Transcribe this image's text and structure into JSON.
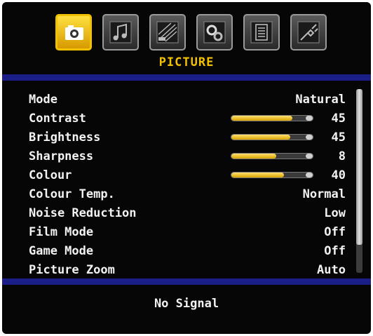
{
  "tabs": [
    {
      "icon": "camera-icon",
      "active": true
    },
    {
      "icon": "music-note-icon",
      "active": false
    },
    {
      "icon": "satellite-install-icon",
      "active": false
    },
    {
      "icon": "gears-icon",
      "active": false
    },
    {
      "icon": "document-icon",
      "active": false
    },
    {
      "icon": "plug-icon",
      "active": false
    }
  ],
  "section_title": "PICTURE",
  "menu": {
    "items": [
      {
        "label": "Mode",
        "value": "Natural"
      },
      {
        "label": "Contrast",
        "value": "45",
        "level": 0.75
      },
      {
        "label": "Brightness",
        "value": "45",
        "level": 0.72
      },
      {
        "label": "Sharpness",
        "value": "8",
        "level": 0.55
      },
      {
        "label": "Colour",
        "value": "40",
        "level": 0.65
      },
      {
        "label": "Colour Temp.",
        "value": "Normal"
      },
      {
        "label": "Noise Reduction",
        "value": "Low"
      },
      {
        "label": "Film Mode",
        "value": "Off"
      },
      {
        "label": "Game Mode",
        "value": "Off"
      },
      {
        "label": "Picture Zoom",
        "value": "Auto"
      }
    ]
  },
  "status_text": "No Signal",
  "colors": {
    "accent": "#f2c200",
    "divider": "#1c1e88",
    "background": "#060606",
    "text": "#f2f2f2"
  }
}
